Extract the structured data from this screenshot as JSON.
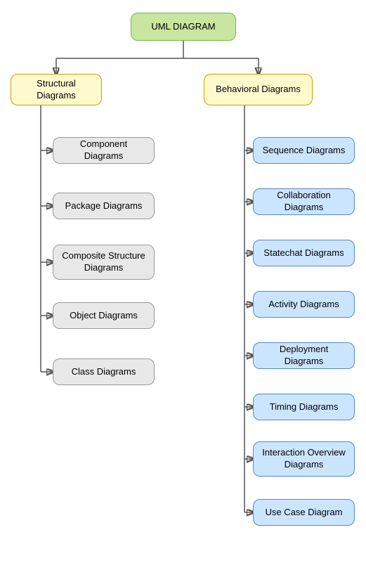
{
  "diagram": {
    "title": "UML DIAGRAM",
    "structural_label": "Structural Diagrams",
    "behavioral_label": "Behavioral Diagrams",
    "structural_children": [
      {
        "label": "Component Diagrams"
      },
      {
        "label": "Package Diagrams"
      },
      {
        "label": "Composite Structure\nDiagrams"
      },
      {
        "label": "Object Diagrams"
      },
      {
        "label": "Class Diagrams"
      }
    ],
    "behavioral_children": [
      {
        "label": "Sequence Diagrams"
      },
      {
        "label": "Collaboration Diagrams"
      },
      {
        "label": "Statechat Diagrams"
      },
      {
        "label": "Activity Diagrams"
      },
      {
        "label": "Deployment Diagrams"
      },
      {
        "label": "Timing Diagrams"
      },
      {
        "label": "Interaction Overview\nDiagrams"
      },
      {
        "label": "Use Case Diagram"
      }
    ]
  }
}
